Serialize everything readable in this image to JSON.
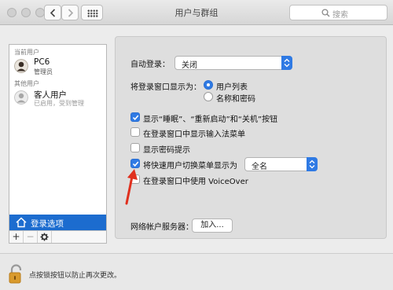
{
  "window": {
    "title": "用户与群组"
  },
  "search": {
    "placeholder": "搜索"
  },
  "sidebar": {
    "current_users_label": "当前用户",
    "current_user": {
      "name": "PC6",
      "role": "管理员"
    },
    "other_users_label": "其他用户",
    "guest_user": {
      "name": "客人用户",
      "status": "已启用，受到管理"
    },
    "login_options_label": "登录选项",
    "toolbar": {
      "add": "+",
      "remove": "−"
    }
  },
  "main": {
    "auto_login_label": "自动登录：",
    "auto_login_value": "关闭",
    "display_login_as_label": "将登录窗口显示为：",
    "radio_user_list": "用户列表",
    "radio_name_password": "名称和密码",
    "check_show_buttons": "显示“睡眠”、“重新启动”和“关机”按钮",
    "check_input_menu": "在登录窗口中显示输入法菜单",
    "check_password_hints": "显示密码提示",
    "check_fast_user_switching": "将快速用户切换菜单显示为",
    "fast_user_switching_value": "全名",
    "check_voiceover": "在登录窗口中使用 VoiceOver",
    "network_server_label": "网络帐户服务器：",
    "join_button": "加入..."
  },
  "states": {
    "radio_user_list_selected": true,
    "check_show_buttons": true,
    "check_input_menu": false,
    "check_password_hints": false,
    "check_fast_user_switching": true,
    "check_voiceover": false
  },
  "footer": {
    "lock_text": "点按锁按钮以防止再次更改。"
  },
  "colors": {
    "accent": "#2f7ae4",
    "selection": "#1c6ccf",
    "arrow": "#e0301e"
  }
}
